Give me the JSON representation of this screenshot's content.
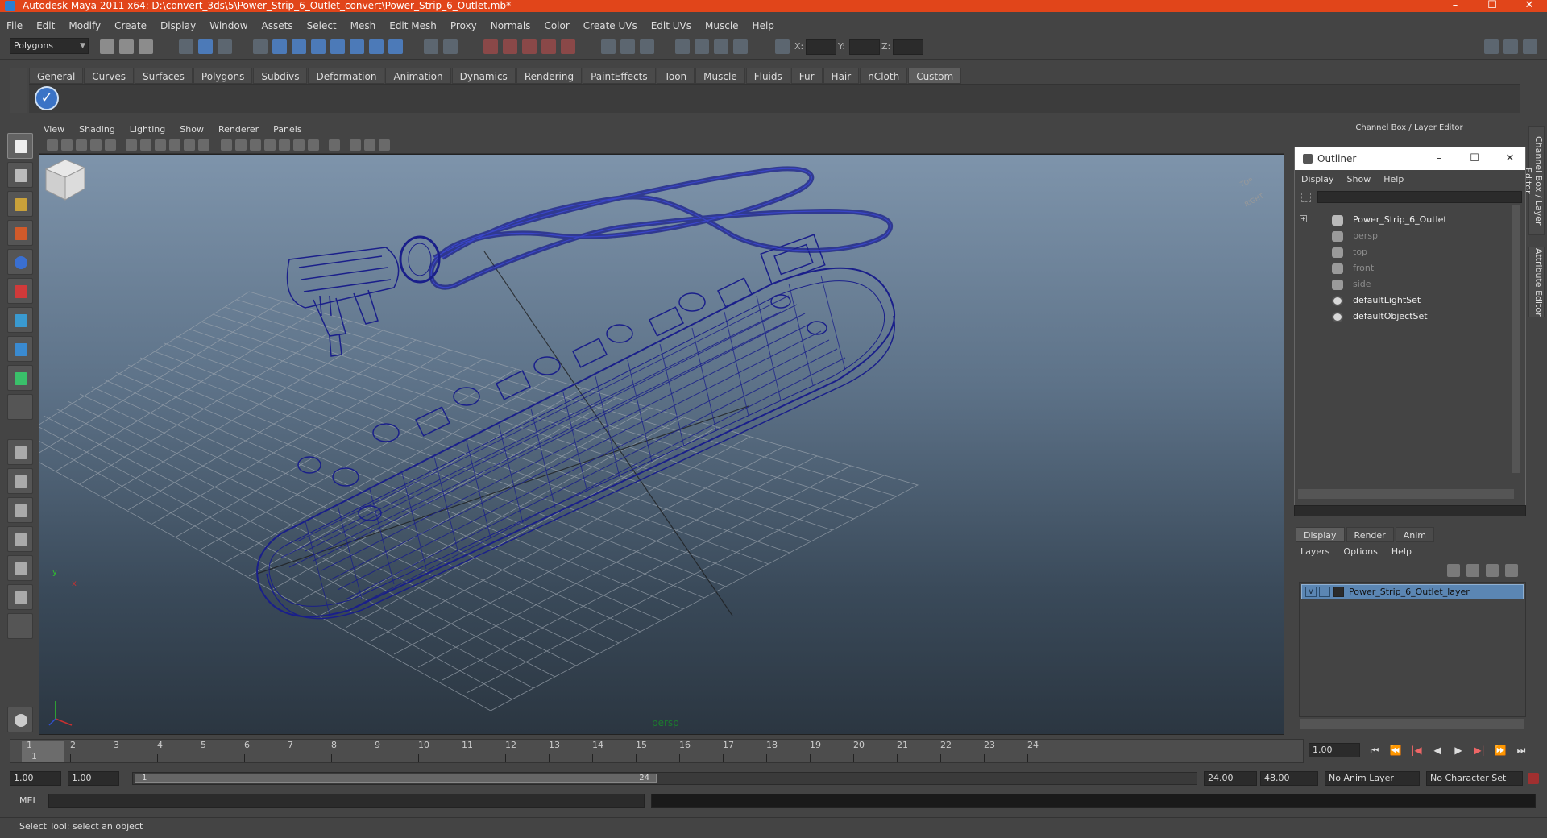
{
  "window": {
    "title": "Autodesk Maya 2011 x64: D:\\convert_3ds\\5\\Power_Strip_6_Outlet_convert\\Power_Strip_6_Outlet.mb*",
    "controls": [
      "–",
      "☐",
      "✕"
    ]
  },
  "menus": [
    "File",
    "Edit",
    "Modify",
    "Create",
    "Display",
    "Window",
    "Assets",
    "Select",
    "Mesh",
    "Edit Mesh",
    "Proxy",
    "Normals",
    "Color",
    "Create UVs",
    "Edit UVs",
    "Muscle",
    "Help"
  ],
  "status_line": {
    "mode": "Polygons",
    "coord_labels": [
      "X:",
      "Y:",
      "Z:"
    ]
  },
  "shelf": {
    "tabs": [
      "General",
      "Curves",
      "Surfaces",
      "Polygons",
      "Subdivs",
      "Deformation",
      "Animation",
      "Dynamics",
      "Rendering",
      "PaintEffects",
      "Toon",
      "Muscle",
      "Fluids",
      "Fur",
      "Hair",
      "nCloth",
      "Custom"
    ],
    "active_tab": "Custom"
  },
  "viewport": {
    "menus": [
      "View",
      "Shading",
      "Lighting",
      "Show",
      "Renderer",
      "Panels"
    ],
    "camera_label": "persp",
    "viewcube": {
      "top": "TOP",
      "right": "RIGHT"
    },
    "axis": {
      "x": "x",
      "y": "y"
    }
  },
  "channel_box": {
    "header": "Channel Box / Layer Editor",
    "side_tabs": [
      "Channel Box / Layer Editor",
      "Attribute Editor"
    ]
  },
  "outliner": {
    "title": "Outliner",
    "menus": [
      "Display",
      "Show",
      "Help"
    ],
    "items": [
      {
        "label": "Power_Strip_6_Outlet",
        "icon": "mesh-icon",
        "dim": false
      },
      {
        "label": "persp",
        "icon": "camera-icon",
        "dim": true
      },
      {
        "label": "top",
        "icon": "camera-icon",
        "dim": true
      },
      {
        "label": "front",
        "icon": "camera-icon",
        "dim": true
      },
      {
        "label": "side",
        "icon": "camera-icon",
        "dim": true
      },
      {
        "label": "defaultLightSet",
        "icon": "set-icon",
        "dim": false
      },
      {
        "label": "defaultObjectSet",
        "icon": "set-icon",
        "dim": false
      }
    ],
    "expand_glyph": "+"
  },
  "layer_editor": {
    "tabs": [
      "Display",
      "Render",
      "Anim"
    ],
    "active_tab": "Display",
    "menus": [
      "Layers",
      "Options",
      "Help"
    ],
    "layers": [
      {
        "visible": "V",
        "name": "Power_Strip_6_Outlet_layer"
      }
    ]
  },
  "timeline": {
    "frames": [
      "1",
      "2",
      "3",
      "4",
      "5",
      "6",
      "7",
      "8",
      "9",
      "10",
      "11",
      "12",
      "13",
      "14",
      "15",
      "16",
      "17",
      "18",
      "19",
      "20",
      "21",
      "22",
      "23",
      "24"
    ],
    "current_frame_label": "1",
    "current_time": "1.00",
    "playback_buttons": [
      "⏮",
      "⏪",
      "|◀",
      "◀",
      "▶",
      "▶|",
      "⏩",
      "⏭"
    ]
  },
  "range_slider": {
    "start_time": "1.00",
    "playback_start": "1.00",
    "handle_start": "1",
    "handle_end": "24",
    "playback_end": "24.00",
    "end_time": "48.00",
    "anim_layer": "No Anim Layer",
    "character_set": "No Character Set"
  },
  "command_line": {
    "label": "MEL"
  },
  "help_line": {
    "text": "Select Tool: select an object"
  },
  "colors": {
    "title_bar": "#e1451a",
    "wireframe": "#1a1f8a",
    "selection": "#5b86b3",
    "camera_label": "#1c7a2e"
  }
}
